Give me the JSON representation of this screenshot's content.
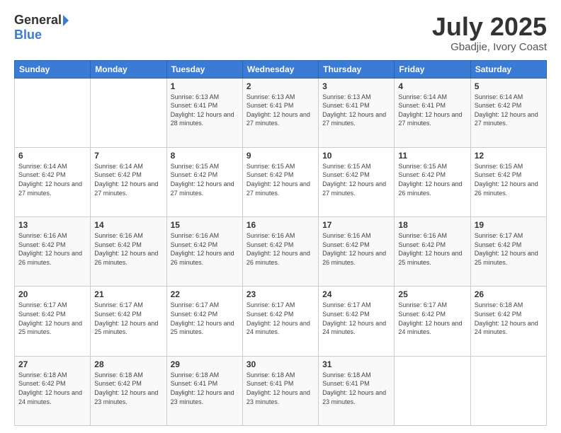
{
  "header": {
    "logo_general": "General",
    "logo_blue": "Blue",
    "month_title": "July 2025",
    "location": "Gbadjie, Ivory Coast"
  },
  "weekdays": [
    "Sunday",
    "Monday",
    "Tuesday",
    "Wednesday",
    "Thursday",
    "Friday",
    "Saturday"
  ],
  "weeks": [
    [
      {
        "day": "",
        "sunrise": "",
        "sunset": "",
        "daylight": ""
      },
      {
        "day": "",
        "sunrise": "",
        "sunset": "",
        "daylight": ""
      },
      {
        "day": "1",
        "sunrise": "Sunrise: 6:13 AM",
        "sunset": "Sunset: 6:41 PM",
        "daylight": "Daylight: 12 hours and 28 minutes."
      },
      {
        "day": "2",
        "sunrise": "Sunrise: 6:13 AM",
        "sunset": "Sunset: 6:41 PM",
        "daylight": "Daylight: 12 hours and 27 minutes."
      },
      {
        "day": "3",
        "sunrise": "Sunrise: 6:13 AM",
        "sunset": "Sunset: 6:41 PM",
        "daylight": "Daylight: 12 hours and 27 minutes."
      },
      {
        "day": "4",
        "sunrise": "Sunrise: 6:14 AM",
        "sunset": "Sunset: 6:41 PM",
        "daylight": "Daylight: 12 hours and 27 minutes."
      },
      {
        "day": "5",
        "sunrise": "Sunrise: 6:14 AM",
        "sunset": "Sunset: 6:42 PM",
        "daylight": "Daylight: 12 hours and 27 minutes."
      }
    ],
    [
      {
        "day": "6",
        "sunrise": "Sunrise: 6:14 AM",
        "sunset": "Sunset: 6:42 PM",
        "daylight": "Daylight: 12 hours and 27 minutes."
      },
      {
        "day": "7",
        "sunrise": "Sunrise: 6:14 AM",
        "sunset": "Sunset: 6:42 PM",
        "daylight": "Daylight: 12 hours and 27 minutes."
      },
      {
        "day": "8",
        "sunrise": "Sunrise: 6:15 AM",
        "sunset": "Sunset: 6:42 PM",
        "daylight": "Daylight: 12 hours and 27 minutes."
      },
      {
        "day": "9",
        "sunrise": "Sunrise: 6:15 AM",
        "sunset": "Sunset: 6:42 PM",
        "daylight": "Daylight: 12 hours and 27 minutes."
      },
      {
        "day": "10",
        "sunrise": "Sunrise: 6:15 AM",
        "sunset": "Sunset: 6:42 PM",
        "daylight": "Daylight: 12 hours and 27 minutes."
      },
      {
        "day": "11",
        "sunrise": "Sunrise: 6:15 AM",
        "sunset": "Sunset: 6:42 PM",
        "daylight": "Daylight: 12 hours and 26 minutes."
      },
      {
        "day": "12",
        "sunrise": "Sunrise: 6:15 AM",
        "sunset": "Sunset: 6:42 PM",
        "daylight": "Daylight: 12 hours and 26 minutes."
      }
    ],
    [
      {
        "day": "13",
        "sunrise": "Sunrise: 6:16 AM",
        "sunset": "Sunset: 6:42 PM",
        "daylight": "Daylight: 12 hours and 26 minutes."
      },
      {
        "day": "14",
        "sunrise": "Sunrise: 6:16 AM",
        "sunset": "Sunset: 6:42 PM",
        "daylight": "Daylight: 12 hours and 26 minutes."
      },
      {
        "day": "15",
        "sunrise": "Sunrise: 6:16 AM",
        "sunset": "Sunset: 6:42 PM",
        "daylight": "Daylight: 12 hours and 26 minutes."
      },
      {
        "day": "16",
        "sunrise": "Sunrise: 6:16 AM",
        "sunset": "Sunset: 6:42 PM",
        "daylight": "Daylight: 12 hours and 26 minutes."
      },
      {
        "day": "17",
        "sunrise": "Sunrise: 6:16 AM",
        "sunset": "Sunset: 6:42 PM",
        "daylight": "Daylight: 12 hours and 26 minutes."
      },
      {
        "day": "18",
        "sunrise": "Sunrise: 6:16 AM",
        "sunset": "Sunset: 6:42 PM",
        "daylight": "Daylight: 12 hours and 25 minutes."
      },
      {
        "day": "19",
        "sunrise": "Sunrise: 6:17 AM",
        "sunset": "Sunset: 6:42 PM",
        "daylight": "Daylight: 12 hours and 25 minutes."
      }
    ],
    [
      {
        "day": "20",
        "sunrise": "Sunrise: 6:17 AM",
        "sunset": "Sunset: 6:42 PM",
        "daylight": "Daylight: 12 hours and 25 minutes."
      },
      {
        "day": "21",
        "sunrise": "Sunrise: 6:17 AM",
        "sunset": "Sunset: 6:42 PM",
        "daylight": "Daylight: 12 hours and 25 minutes."
      },
      {
        "day": "22",
        "sunrise": "Sunrise: 6:17 AM",
        "sunset": "Sunset: 6:42 PM",
        "daylight": "Daylight: 12 hours and 25 minutes."
      },
      {
        "day": "23",
        "sunrise": "Sunrise: 6:17 AM",
        "sunset": "Sunset: 6:42 PM",
        "daylight": "Daylight: 12 hours and 24 minutes."
      },
      {
        "day": "24",
        "sunrise": "Sunrise: 6:17 AM",
        "sunset": "Sunset: 6:42 PM",
        "daylight": "Daylight: 12 hours and 24 minutes."
      },
      {
        "day": "25",
        "sunrise": "Sunrise: 6:17 AM",
        "sunset": "Sunset: 6:42 PM",
        "daylight": "Daylight: 12 hours and 24 minutes."
      },
      {
        "day": "26",
        "sunrise": "Sunrise: 6:18 AM",
        "sunset": "Sunset: 6:42 PM",
        "daylight": "Daylight: 12 hours and 24 minutes."
      }
    ],
    [
      {
        "day": "27",
        "sunrise": "Sunrise: 6:18 AM",
        "sunset": "Sunset: 6:42 PM",
        "daylight": "Daylight: 12 hours and 24 minutes."
      },
      {
        "day": "28",
        "sunrise": "Sunrise: 6:18 AM",
        "sunset": "Sunset: 6:42 PM",
        "daylight": "Daylight: 12 hours and 23 minutes."
      },
      {
        "day": "29",
        "sunrise": "Sunrise: 6:18 AM",
        "sunset": "Sunset: 6:41 PM",
        "daylight": "Daylight: 12 hours and 23 minutes."
      },
      {
        "day": "30",
        "sunrise": "Sunrise: 6:18 AM",
        "sunset": "Sunset: 6:41 PM",
        "daylight": "Daylight: 12 hours and 23 minutes."
      },
      {
        "day": "31",
        "sunrise": "Sunrise: 6:18 AM",
        "sunset": "Sunset: 6:41 PM",
        "daylight": "Daylight: 12 hours and 23 minutes."
      },
      {
        "day": "",
        "sunrise": "",
        "sunset": "",
        "daylight": ""
      },
      {
        "day": "",
        "sunrise": "",
        "sunset": "",
        "daylight": ""
      }
    ]
  ]
}
